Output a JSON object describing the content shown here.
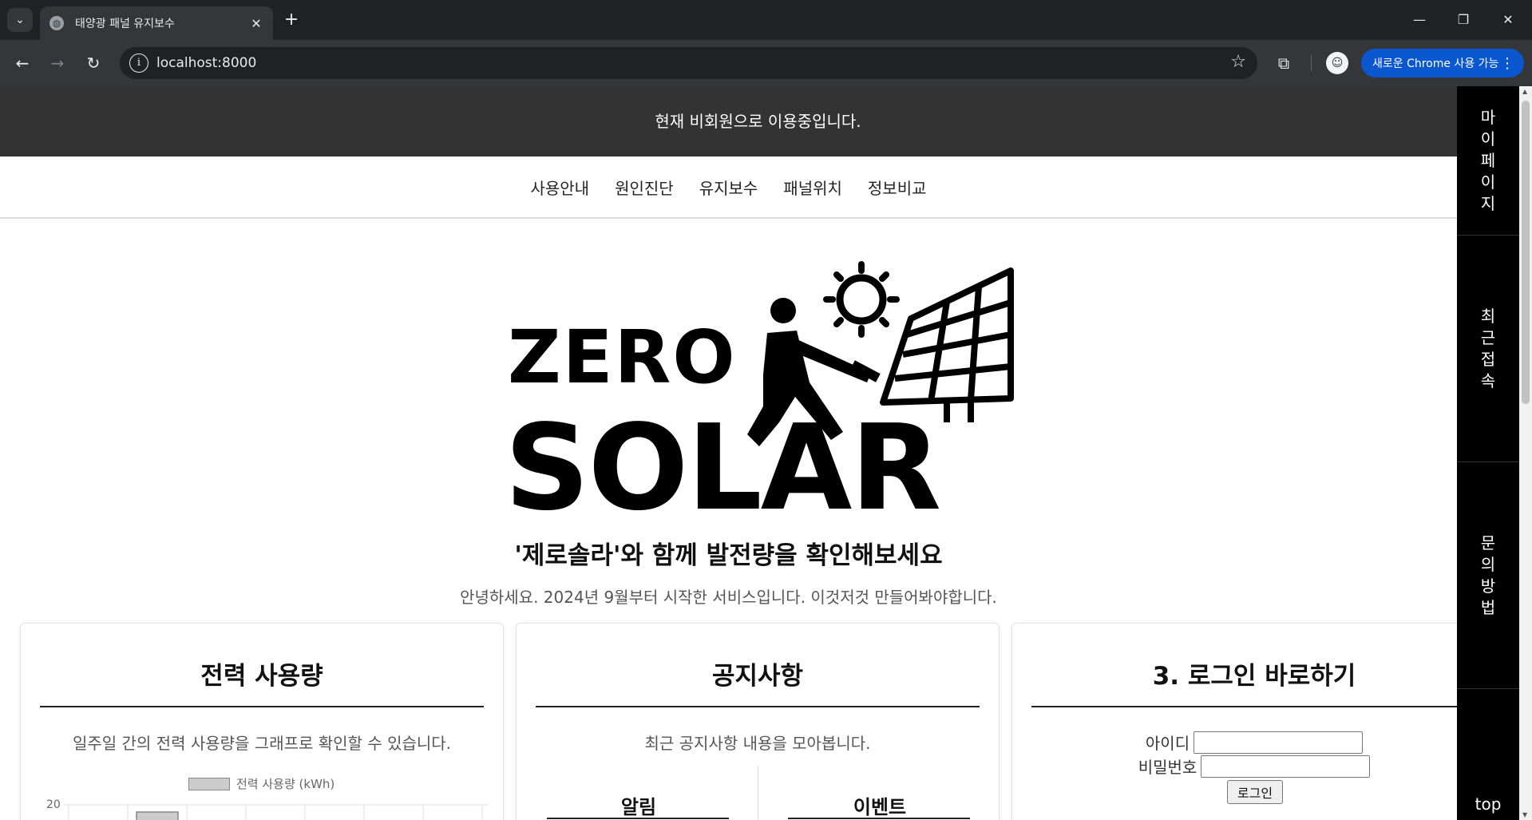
{
  "browser": {
    "tab_title": "태양광 패널 유지보수",
    "url": "localhost:8000",
    "update_label": "새로운 Chrome 사용 가능",
    "icons": [
      "tab-search-icon",
      "globe-icon",
      "close-icon",
      "plus-icon",
      "minimize-icon",
      "restore-icon",
      "window-close-icon",
      "back-arrow-icon",
      "forward-arrow-icon",
      "reload-icon",
      "site-info-icon",
      "star-icon",
      "extensions-icon",
      "profile-avatar-icon",
      "more-vert-icon"
    ]
  },
  "header": {
    "status": "현재 비회원으로 이용중입니다."
  },
  "nav": {
    "items": [
      {
        "label": "사용안내"
      },
      {
        "label": "원인진단"
      },
      {
        "label": "유지보수"
      },
      {
        "label": "패널위치"
      },
      {
        "label": "정보비교"
      }
    ]
  },
  "sidebar": {
    "items": [
      {
        "label": "마이페이지"
      },
      {
        "label": "최근접속"
      },
      {
        "label": "문의방법"
      }
    ],
    "top_label": "top"
  },
  "logo": {
    "line1": "ZERO",
    "line2": "SOLAR"
  },
  "hero": {
    "headline": "'제로솔라'와 함께 발전량을 확인해보세요",
    "subline": "안녕하세요. 2024년 9월부터 시작한 서비스입니다. 이것저것 만들어봐야합니다."
  },
  "cards": {
    "usage": {
      "title": "전력 사용량",
      "desc": "일주일 간의 전력 사용량을 그래프로 확인할 수 있습니다."
    },
    "notice": {
      "title": "공지사항",
      "desc": "최근 공지사항 내용을 모아봅니다.",
      "col_left": "알림",
      "col_right": "이벤트"
    },
    "login": {
      "title": "3. 로그인 바로하기",
      "id_label": "아이디",
      "pw_label": "비밀번호",
      "button": "로그인"
    }
  },
  "chart_data": {
    "type": "bar",
    "legend": "전력 사용량 (kWh)",
    "ytick_visible": "20",
    "series": [
      {
        "name": "전력 사용량 (kWh)",
        "color": "#cccccc",
        "border": "#888888"
      }
    ]
  }
}
